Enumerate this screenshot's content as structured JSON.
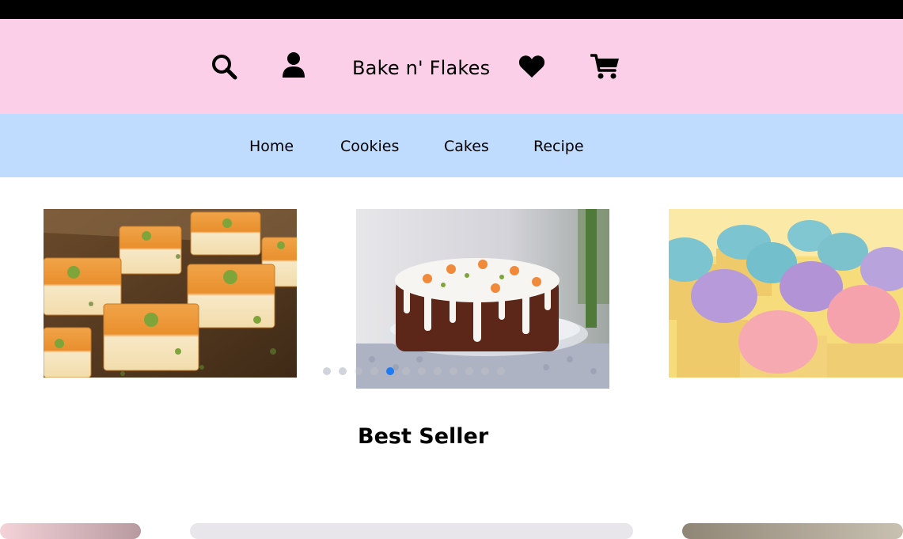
{
  "header": {
    "brand": "Bake n' Flakes",
    "icons": [
      "search-icon",
      "user-icon",
      "heart-icon",
      "cart-icon"
    ]
  },
  "nav": {
    "items": [
      {
        "label": "Home"
      },
      {
        "label": "Cookies"
      },
      {
        "label": "Cakes"
      },
      {
        "label": "Recipe"
      }
    ]
  },
  "carousel": {
    "slides": [
      {
        "subject": "pistachio dessert squares"
      },
      {
        "subject": "carrot cake with white icing"
      },
      {
        "subject": "pastel frosted cupcakes"
      }
    ],
    "dot_count": 12,
    "active_dot": 4
  },
  "best_seller": {
    "title": "Best Seller"
  },
  "colors": {
    "top_bar": "#000000",
    "header_bg": "#fbcfe8",
    "nav_bg": "#bfdbfe",
    "dot_active": "#1e7bf2",
    "dot_inactive": "#d1d5db"
  }
}
